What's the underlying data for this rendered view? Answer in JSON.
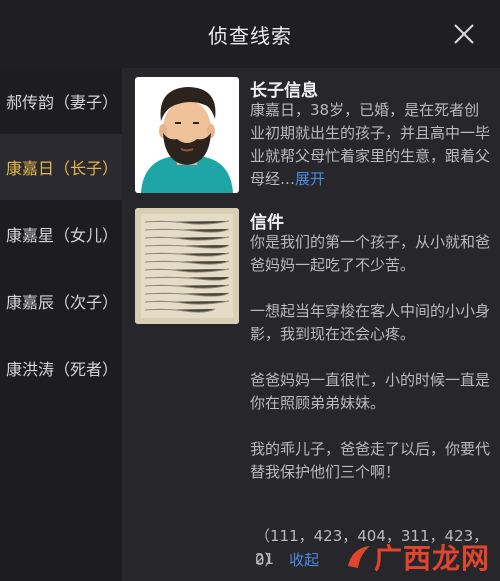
{
  "header": {
    "title": "侦查线索"
  },
  "sidebar": {
    "items": [
      {
        "label": "郝传韵（妻子）",
        "active": false
      },
      {
        "label": "康嘉日（长子）",
        "active": true
      },
      {
        "label": "康嘉星（女儿）",
        "active": false
      },
      {
        "label": "康嘉辰（次子）",
        "active": false
      },
      {
        "label": "康洪涛（死者）",
        "active": false
      }
    ]
  },
  "info_card": {
    "title": "长子信息",
    "text": "康嘉日，38岁，已婚，是在死者创业初期就出生的孩子，并且高中一毕业就帮父母忙着家里的生意，跟着父母经…",
    "expand_label": "展开"
  },
  "letter_card": {
    "title": "信件",
    "paragraphs": [
      "你是我们的第一个孩子，从小就和爸爸妈妈一起吃了不少苦。",
      "一想起当年穿梭在客人中间的小小身影，我到现在还会心疼。",
      "爸爸妈妈一直很忙，小的时候一直是你在照顾弟弟妹妹。",
      "我的乖儿子，爸爸走了以后，你要代替我保护他们三个啊！"
    ],
    "codes_line1": "（111，423，404，311，423，21",
    "codes_line2": "0）",
    "collapse_label": "收起"
  },
  "watermark": {
    "text": "广西龙网"
  },
  "colors": {
    "accent": "#e4b64a",
    "link": "#4a8be0",
    "background": "#1c1c21",
    "panel": "#26262b"
  }
}
